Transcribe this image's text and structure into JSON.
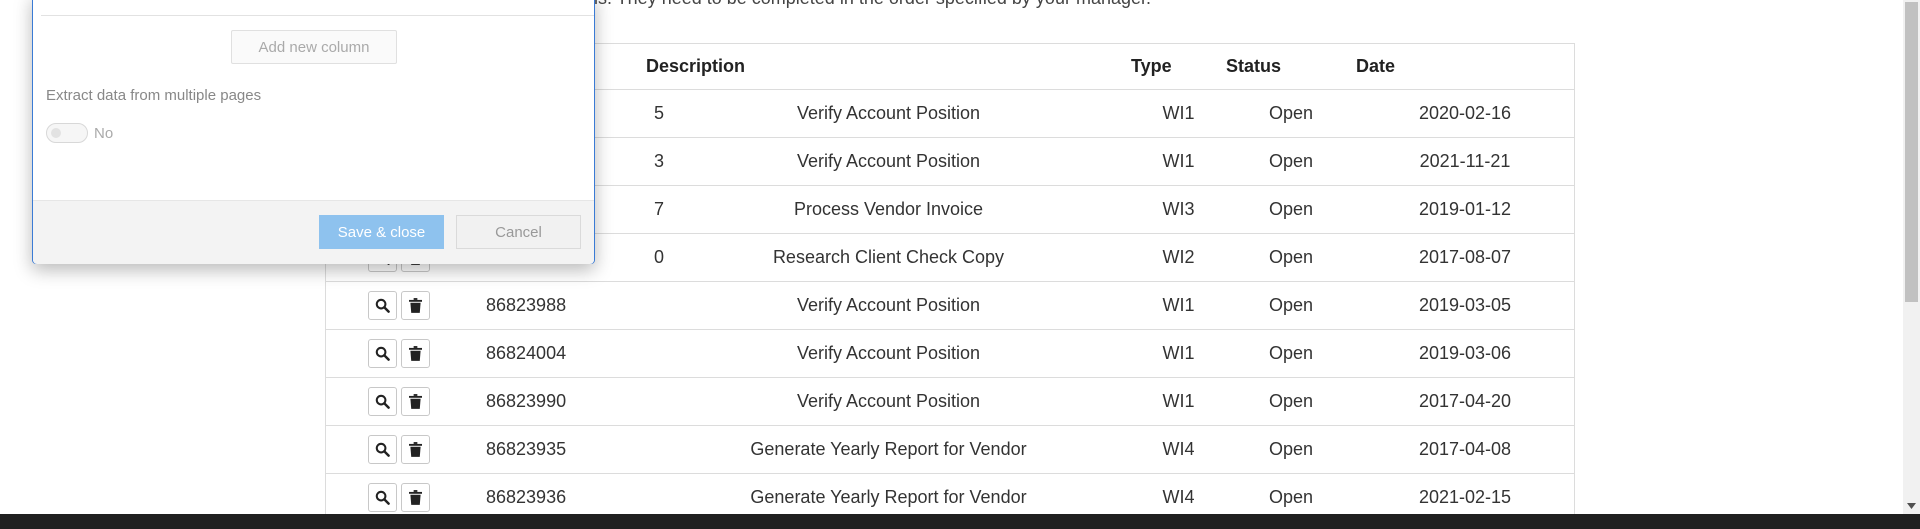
{
  "page": {
    "intro_text": "is. They need to be completed in the order specified by your manager."
  },
  "table": {
    "headers": {
      "actions": "",
      "id": "",
      "description": "Description",
      "type": "Type",
      "status": "Status",
      "date": "Date"
    },
    "rows": [
      {
        "id": "",
        "description": "Verify Account Position",
        "type": "WI1",
        "status": "Open",
        "date": "2020-02-16",
        "id_partial": "5"
      },
      {
        "id": "",
        "description": "Verify Account Position",
        "type": "WI1",
        "status": "Open",
        "date": "2021-11-21",
        "id_partial": "3"
      },
      {
        "id": "",
        "description": "Process Vendor Invoice",
        "type": "WI3",
        "status": "Open",
        "date": "2019-01-12",
        "id_partial": "7"
      },
      {
        "id": "",
        "description": "Research Client Check Copy",
        "type": "WI2",
        "status": "Open",
        "date": "2017-08-07",
        "id_partial": "0"
      },
      {
        "id": "86823988",
        "description": "Verify Account Position",
        "type": "WI1",
        "status": "Open",
        "date": "2019-03-05"
      },
      {
        "id": "86824004",
        "description": "Verify Account Position",
        "type": "WI1",
        "status": "Open",
        "date": "2019-03-06"
      },
      {
        "id": "86823990",
        "description": "Verify Account Position",
        "type": "WI1",
        "status": "Open",
        "date": "2017-04-20"
      },
      {
        "id": "86823935",
        "description": "Generate Yearly Report for Vendor",
        "type": "WI4",
        "status": "Open",
        "date": "2017-04-08"
      },
      {
        "id": "86823936",
        "description": "Generate Yearly Report for Vendor",
        "type": "WI4",
        "status": "Open",
        "date": "2021-02-15"
      }
    ]
  },
  "modal": {
    "add_column_label": "Add new column",
    "extract_label": "Extract data from multiple pages",
    "toggle_value": "No",
    "save_label": "Save & close",
    "cancel_label": "Cancel"
  },
  "icons": {
    "view": "magnifier-icon",
    "delete": "trash-icon"
  },
  "colors": {
    "save_button": "#8ec2ee",
    "modal_border": "#3a7bd5"
  }
}
